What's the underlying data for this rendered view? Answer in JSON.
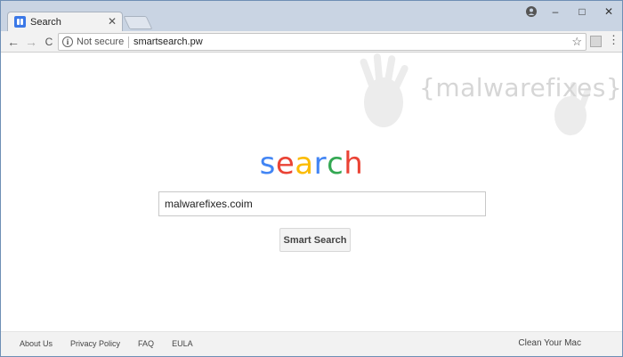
{
  "tab": {
    "title": "Search",
    "close": "✕"
  },
  "window": {
    "minimize": "–",
    "maximize": "□",
    "close": "✕"
  },
  "toolbar": {
    "back": "←",
    "forward": "→",
    "reload": "C",
    "security_label": "Not secure",
    "url": "smartsearch.pw",
    "bookmark": "☆",
    "menu": "⋮"
  },
  "watermark": {
    "text": "{malwarefixes}"
  },
  "logo": {
    "letters": [
      "s",
      "e",
      "a",
      "r",
      "c",
      "h"
    ],
    "colors": [
      "#4285F4",
      "#EA4335",
      "#FBBC05",
      "#4285F4",
      "#34A853",
      "#EA4335"
    ]
  },
  "search": {
    "value": "malwarefixes.coim",
    "button_label": "Smart Search"
  },
  "footer": {
    "links": [
      "About Us",
      "Privacy Policy",
      "FAQ",
      "EULA"
    ],
    "right_link": "Clean Your Mac"
  }
}
